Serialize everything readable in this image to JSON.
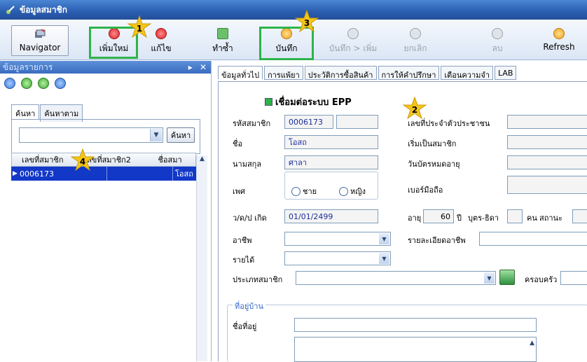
{
  "window": {
    "title": "ข้อมูลสมาชิก"
  },
  "toolbar": {
    "navigator": "Navigator",
    "new": "เพิ่มใหม่",
    "edit": "แก้ไข",
    "duplicate": "ทำซ้ำ",
    "save": "บันทึก",
    "save_new": "บันทึก > เพิ่ม",
    "cancel": "ยกเลิก",
    "delete": "ลบ",
    "refresh": "Refresh"
  },
  "callouts": [
    "1",
    "2",
    "3",
    "4"
  ],
  "left_panel": {
    "title": "ข้อมูลรายการ",
    "close": "✕",
    "pin": "▸",
    "tabs": [
      "ค้นหา",
      "ค้นหาตาม"
    ],
    "search_value": "",
    "search_button": "ค้นหา",
    "columns": [
      "เลขที่สมาชิก",
      "เลขที่สมาชิก2",
      "ชื่อสมา"
    ],
    "rows": [
      {
        "id": "0006173",
        "id2": "",
        "name": "โอสถ"
      }
    ]
  },
  "main": {
    "tabs": [
      "ข้อมูลทั่วไป",
      "การแพ้ยา",
      "ประวัติการซื้อสินค้า",
      "การให้คำปรึกษา",
      "เตือนความจำ",
      "LAB"
    ],
    "epp_label": "เชื่อมต่อระบบ EPP",
    "labels": {
      "member_code": "รหัสสมาชิก",
      "first_name": "ชื่อ",
      "last_name": "นามสกุล",
      "gender": "เพศ",
      "dob": "ว/ด/ป เกิด",
      "occupation": "อาชีพ",
      "income": "รายได้",
      "member_type": "ประเภทสมาชิก",
      "citizen_id": "เลขที่ประจำตัวประชาชน",
      "member_since": "เริ่มเป็นสมาชิก",
      "card_expiry": "วันบัตรหมดอายุ",
      "mobile": "เบอร์มือถือ",
      "age": "อายุ",
      "children": "บุตร-ธิดา",
      "people": "คน",
      "status": "สถานะ",
      "occupation_detail": "รายละเอียดอาชีพ",
      "family": "ครอบครัว",
      "address_section": "ที่อยู่บ้าน",
      "address_name": "ชื่อที่อยู่"
    },
    "values": {
      "member_code": "0006173",
      "first_name": "โอสถ",
      "last_name": "ศาลา",
      "gender_male": "ชาย",
      "gender_female": "หญิง",
      "dob": "01/01/2499",
      "age": "60",
      "age_unit": "ปี"
    }
  },
  "colors": {
    "highlight": "#2eb34a",
    "star": "#f5c518",
    "selection": "#1238c8",
    "title_bar": "#2a5db0"
  }
}
